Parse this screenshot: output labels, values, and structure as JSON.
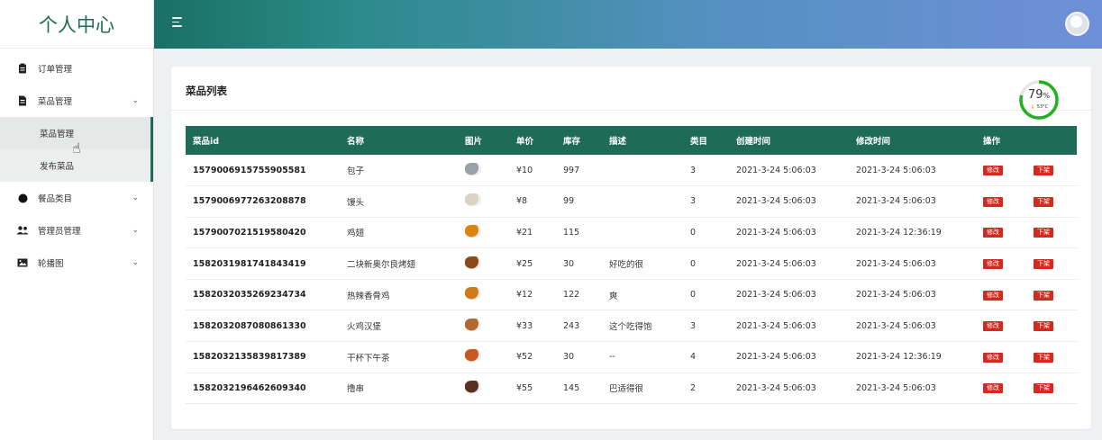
{
  "sidebar": {
    "brand": "个人中心",
    "items": [
      {
        "label": "订单管理"
      },
      {
        "label": "菜品管理"
      },
      {
        "label": "菜品管理"
      },
      {
        "label": "发布菜品"
      },
      {
        "label": "餐品类目"
      },
      {
        "label": "管理员管理"
      },
      {
        "label": "轮播图"
      }
    ]
  },
  "main": {
    "title": "菜品列表",
    "gauge": {
      "value": "79",
      "unit": "%",
      "temp": "53°C",
      "fraction": 0.79
    }
  },
  "table": {
    "columns": [
      "菜品id",
      "名称",
      "图片",
      "单价",
      "库存",
      "描述",
      "类目",
      "创建时间",
      "修改时间",
      "操作"
    ],
    "edit_label": "修改",
    "off_label": "下架",
    "rows": [
      {
        "id": "1579006915755905581",
        "name": "包子",
        "price": "¥10",
        "stock": "997",
        "desc": "",
        "cat": "3",
        "created": "2021-3-24 5:06:03",
        "modified": "2021-3-24 5:06:03"
      },
      {
        "id": "1579006977263208878",
        "name": "馒头",
        "price": "¥8",
        "stock": "99",
        "desc": "",
        "cat": "3",
        "created": "2021-3-24 5:06:03",
        "modified": "2021-3-24 5:06:03"
      },
      {
        "id": "1579007021519580420",
        "name": "鸡翅",
        "price": "¥21",
        "stock": "115",
        "desc": "",
        "cat": "0",
        "created": "2021-3-24 5:06:03",
        "modified": "2021-3-24 12:36:19"
      },
      {
        "id": "1582031981741843419",
        "name": "二块新奥尔良烤翅",
        "price": "¥25",
        "stock": "30",
        "desc": "好吃的很",
        "cat": "0",
        "created": "2021-3-24 5:06:03",
        "modified": "2021-3-24 5:06:03"
      },
      {
        "id": "1582032035269234734",
        "name": "热辣香骨鸡",
        "price": "¥12",
        "stock": "122",
        "desc": "爽",
        "cat": "0",
        "created": "2021-3-24 5:06:03",
        "modified": "2021-3-24 5:06:03"
      },
      {
        "id": "1582032087080861330",
        "name": "火鸡汉堡",
        "price": "¥33",
        "stock": "243",
        "desc": "这个吃得饱",
        "cat": "3",
        "created": "2021-3-24 5:06:03",
        "modified": "2021-3-24 5:06:03"
      },
      {
        "id": "1582032135839817389",
        "name": "干杯下午茶",
        "price": "¥52",
        "stock": "30",
        "desc": "--",
        "cat": "4",
        "created": "2021-3-24 5:06:03",
        "modified": "2021-3-24 12:36:19"
      },
      {
        "id": "1582032196462609340",
        "name": "撸串",
        "price": "¥55",
        "stock": "145",
        "desc": "巴适得很",
        "cat": "2",
        "created": "2021-3-24 5:06:03",
        "modified": "2021-3-24 5:06:03"
      }
    ]
  },
  "colors": {
    "accent": "#1e6b57",
    "danger": "#d5281f",
    "gauge": "#1fb41f"
  }
}
